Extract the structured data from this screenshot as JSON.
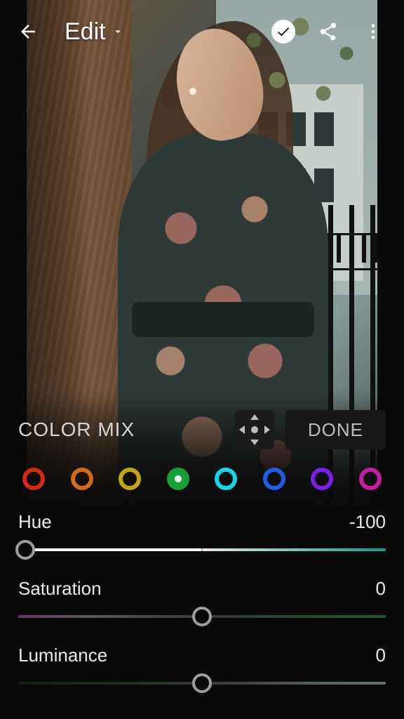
{
  "header": {
    "title": "Edit"
  },
  "panel": {
    "title": "COLOR MIX",
    "done_label": "DONE"
  },
  "colors": [
    {
      "name": "red",
      "hex": "#d22b14",
      "selected": false
    },
    {
      "name": "orange",
      "hex": "#d66a14",
      "selected": false
    },
    {
      "name": "yellow",
      "hex": "#c4a315",
      "selected": false
    },
    {
      "name": "green",
      "hex": "#14a032",
      "selected": true
    },
    {
      "name": "aqua",
      "hex": "#14d6e8",
      "selected": false
    },
    {
      "name": "blue",
      "hex": "#1f5fe8",
      "selected": false
    },
    {
      "name": "purple",
      "hex": "#7a1fe8",
      "selected": false
    },
    {
      "name": "magenta",
      "hex": "#c41f9c",
      "selected": false
    }
  ],
  "sliders": {
    "hue": {
      "label": "Hue",
      "value": "-100",
      "knob_pct": 2
    },
    "saturation": {
      "label": "Saturation",
      "value": "0",
      "knob_pct": 50
    },
    "luminance": {
      "label": "Luminance",
      "value": "0",
      "knob_pct": 50
    }
  }
}
